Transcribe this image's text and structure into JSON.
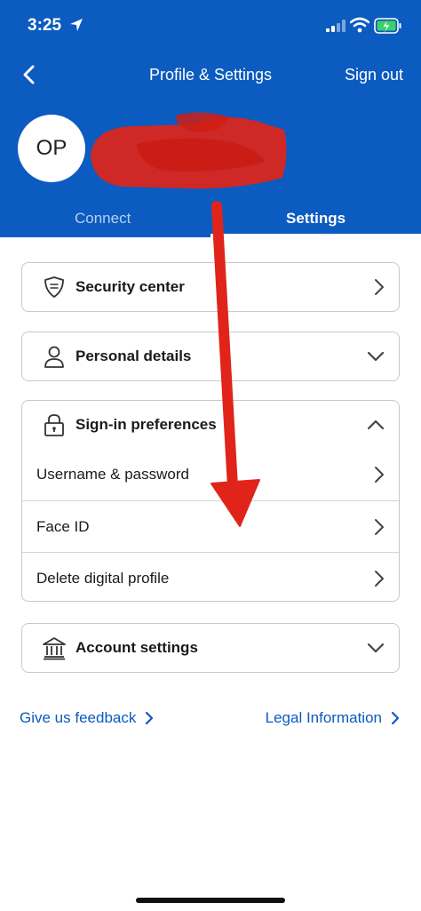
{
  "status_bar": {
    "time": "3:25"
  },
  "nav": {
    "title": "Profile & Settings",
    "sign_out": "Sign out"
  },
  "profile": {
    "initials": "OP"
  },
  "tabs": [
    {
      "label": "Connect",
      "active": false
    },
    {
      "label": "Settings",
      "active": true
    }
  ],
  "sections": {
    "security": {
      "label": "Security center"
    },
    "personal": {
      "label": "Personal details"
    },
    "signin": {
      "label": "Sign-in preferences",
      "items": [
        {
          "label": "Username & password"
        },
        {
          "label": "Face ID"
        },
        {
          "label": "Delete digital profile"
        }
      ]
    },
    "account": {
      "label": "Account settings"
    }
  },
  "footer": {
    "feedback": "Give us feedback",
    "legal": "Legal Information"
  },
  "colors": {
    "brand_blue": "#0b5bc0",
    "annotation_red": "#e0241a"
  }
}
